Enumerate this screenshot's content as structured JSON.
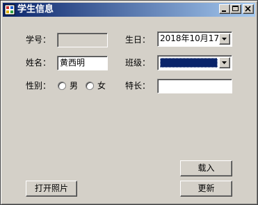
{
  "window": {
    "title": "学生信息"
  },
  "labels": {
    "student_id": "学号：",
    "birthday": "生日：",
    "name": "姓名：",
    "class": "班级：",
    "gender": "性别：",
    "specialty": "特长："
  },
  "fields": {
    "student_id": "",
    "birthday": "2018年10月17日",
    "name": "黄西明",
    "class": "",
    "specialty": ""
  },
  "gender_options": {
    "male": "男",
    "female": "女"
  },
  "buttons": {
    "load": "载入",
    "open_photo": "打开照片",
    "update": "更新"
  },
  "colors": {
    "title_start": "#0a246a",
    "title_end": "#a6caf0",
    "face": "#d4d0c8"
  },
  "icons": [
    "app-icon",
    "minimize-icon",
    "maximize-icon",
    "close-icon",
    "chevron-down-icon"
  ]
}
